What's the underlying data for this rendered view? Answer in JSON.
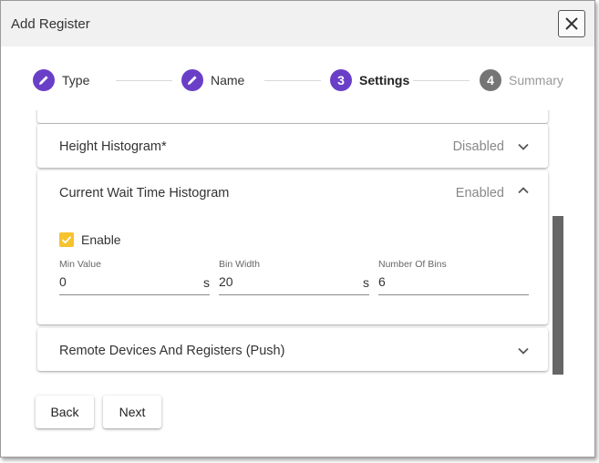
{
  "dialog": {
    "title": "Add Register"
  },
  "stepper": {
    "steps": [
      {
        "label": "Type",
        "state": "completed",
        "number": "",
        "icon": "pencil-icon"
      },
      {
        "label": "Name",
        "state": "completed",
        "number": "",
        "icon": "pencil-icon"
      },
      {
        "label": "Settings",
        "state": "active",
        "number": "3"
      },
      {
        "label": "Summary",
        "state": "inactive",
        "number": "4"
      }
    ]
  },
  "panels": {
    "height_histogram": {
      "title": "Height Histogram*",
      "status": "Disabled",
      "expanded": false
    },
    "wait_time_histogram": {
      "title": "Current Wait Time Histogram",
      "status": "Enabled",
      "expanded": true,
      "enable_label": "Enable",
      "enable_checked": true,
      "fields": {
        "min_value": {
          "label": "Min Value",
          "value": "0",
          "suffix": "s"
        },
        "bin_width": {
          "label": "Bin Width",
          "value": "20",
          "suffix": "s"
        },
        "number_of_bins": {
          "label": "Number Of Bins",
          "value": "6",
          "suffix": ""
        }
      }
    },
    "remote_devices": {
      "title": "Remote Devices And Registers (Push)",
      "status": "",
      "expanded": false
    }
  },
  "actions": {
    "back_label": "Back",
    "next_label": "Next"
  },
  "colors": {
    "accent": "#6a3fc8",
    "inactive_step": "#757575",
    "checkbox": "#f6c22f"
  }
}
